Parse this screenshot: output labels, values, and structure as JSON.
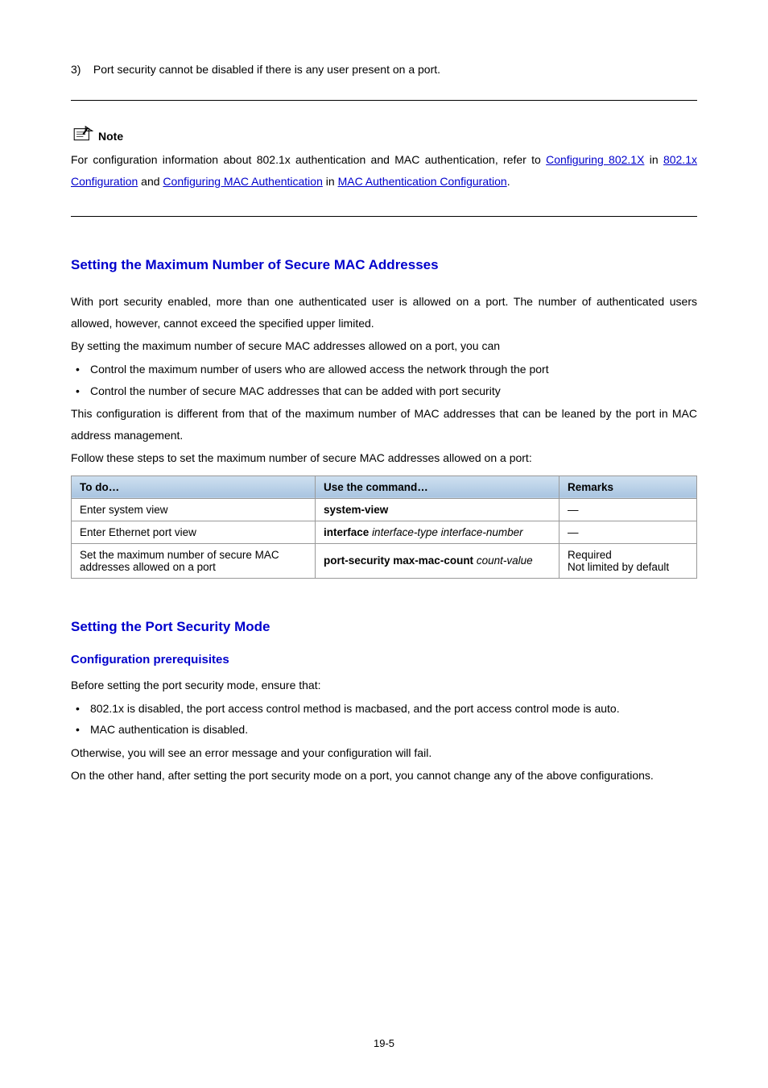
{
  "step": {
    "num": "3)",
    "text": "Port security cannot be disabled if there is any user present on a port."
  },
  "note": {
    "label": "Note",
    "line1_pre": "For configuration information about 802.1x authentication and MAC authentication, refer to ",
    "link1": "Configuring 802.1X",
    "mid1": " in ",
    "link2": "802.1x Configuration",
    "mid2": " and ",
    "link3": "Configuring MAC Authentication",
    "mid3": " in ",
    "link4": "MAC Authentication Configuration",
    "period": "."
  },
  "sec1": {
    "title": "Setting the Maximum Number of Secure MAC Addresses",
    "p1": "With port security enabled, more than one authenticated user is allowed on a port. The number of authenticated users allowed, however, cannot exceed the specified upper limited.",
    "p2": "By setting the maximum number of secure MAC addresses allowed on a port, you can",
    "b1": "Control the maximum number of users who are allowed access the network through the port",
    "b2": "Control the number of secure MAC addresses that can be added with port security",
    "p3": "This configuration is different from that of the maximum number of MAC addresses that can be leaned by the port in MAC address management.",
    "p4": "Follow these steps to set the maximum number of secure MAC addresses allowed on a port:"
  },
  "table": {
    "h1": "To do…",
    "h2": "Use the command…",
    "h3": "Remarks",
    "r1c1": "Enter system view",
    "r1c2": "system-view",
    "r1c3": "—",
    "r2c1": "Enter Ethernet port view",
    "r2c2_cmd": "interface",
    "r2c2_arg": "interface-type interface-number",
    "r2c3": "—",
    "r3c1": "Set the maximum number of secure MAC addresses allowed on a port",
    "r3c2_cmd": "port-security max-mac-count",
    "r3c2_arg": "count-value",
    "r3c3a": "Required",
    "r3c3b": "Not limited by default"
  },
  "sec2": {
    "title": "Setting the Port Security Mode",
    "sub": "Configuration prerequisites",
    "p1": "Before setting the port security mode, ensure that:",
    "b1": "802.1x is disabled, the port access control method is macbased, and the port access control mode is auto.",
    "b2": "MAC authentication is disabled.",
    "p2": "Otherwise, you will see an error message and your configuration will fail.",
    "p3": "On the other hand, after setting the port security mode on a port, you cannot change any of the above configurations."
  },
  "page": "19-5"
}
